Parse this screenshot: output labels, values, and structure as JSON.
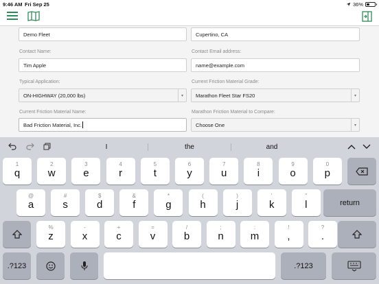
{
  "status_bar": {
    "time": "9:46 AM",
    "date": "Fri Sep 25",
    "battery": "36%",
    "battery_level": 0.36
  },
  "toolbar": {
    "left_icons": [
      "list-icon",
      "map-icon"
    ],
    "right_icon": "sidebar-icon"
  },
  "form": {
    "row1": {
      "left_value": "Demo Fleet",
      "right_value": "Cupertino, CA"
    },
    "contact_name": {
      "label": "Contact Name:",
      "value": "Tim Apple"
    },
    "contact_email": {
      "label": "Contact Email address:",
      "value": "name@example.com"
    },
    "typical_application": {
      "label": "Typical Application:",
      "value": "ON-HIGHWAY (20,000 lbs)"
    },
    "current_grade": {
      "label": "Current Friction Material Grade:",
      "value": "Marathon Fleet Star FS20"
    },
    "current_name": {
      "label": "Current Friction Material Name:",
      "value": "Bad Friction Material, Inc."
    },
    "compare": {
      "label": "Marathon Friction Material to Compare:",
      "value": "Choose One"
    }
  },
  "keyboard": {
    "suggestions": [
      "I",
      "the",
      "and"
    ],
    "row1": [
      {
        "top": "1",
        "main": "q"
      },
      {
        "top": "2",
        "main": "w"
      },
      {
        "top": "3",
        "main": "e"
      },
      {
        "top": "4",
        "main": "r"
      },
      {
        "top": "5",
        "main": "t"
      },
      {
        "top": "6",
        "main": "y"
      },
      {
        "top": "7",
        "main": "u"
      },
      {
        "top": "8",
        "main": "i"
      },
      {
        "top": "9",
        "main": "o"
      },
      {
        "top": "0",
        "main": "p"
      }
    ],
    "row2": [
      {
        "top": "@",
        "main": "a"
      },
      {
        "top": "#",
        "main": "s"
      },
      {
        "top": "$",
        "main": "d"
      },
      {
        "top": "&",
        "main": "f"
      },
      {
        "top": "*",
        "main": "g"
      },
      {
        "top": "(",
        "main": "h"
      },
      {
        "top": ")",
        "main": "j"
      },
      {
        "top": "'",
        "main": "k"
      },
      {
        "top": "\"",
        "main": "l"
      }
    ],
    "row3": [
      {
        "top": "%",
        "main": "z"
      },
      {
        "top": "-",
        "main": "x"
      },
      {
        "top": "+",
        "main": "c"
      },
      {
        "top": "=",
        "main": "v"
      },
      {
        "top": "/",
        "main": "b"
      },
      {
        "top": ";",
        "main": "n"
      },
      {
        "top": ":",
        "main": "m"
      },
      {
        "top": "!",
        "main": ","
      },
      {
        "top": "?",
        "main": "."
      }
    ],
    "return_label": "return",
    "numbers_label": ".?123"
  }
}
